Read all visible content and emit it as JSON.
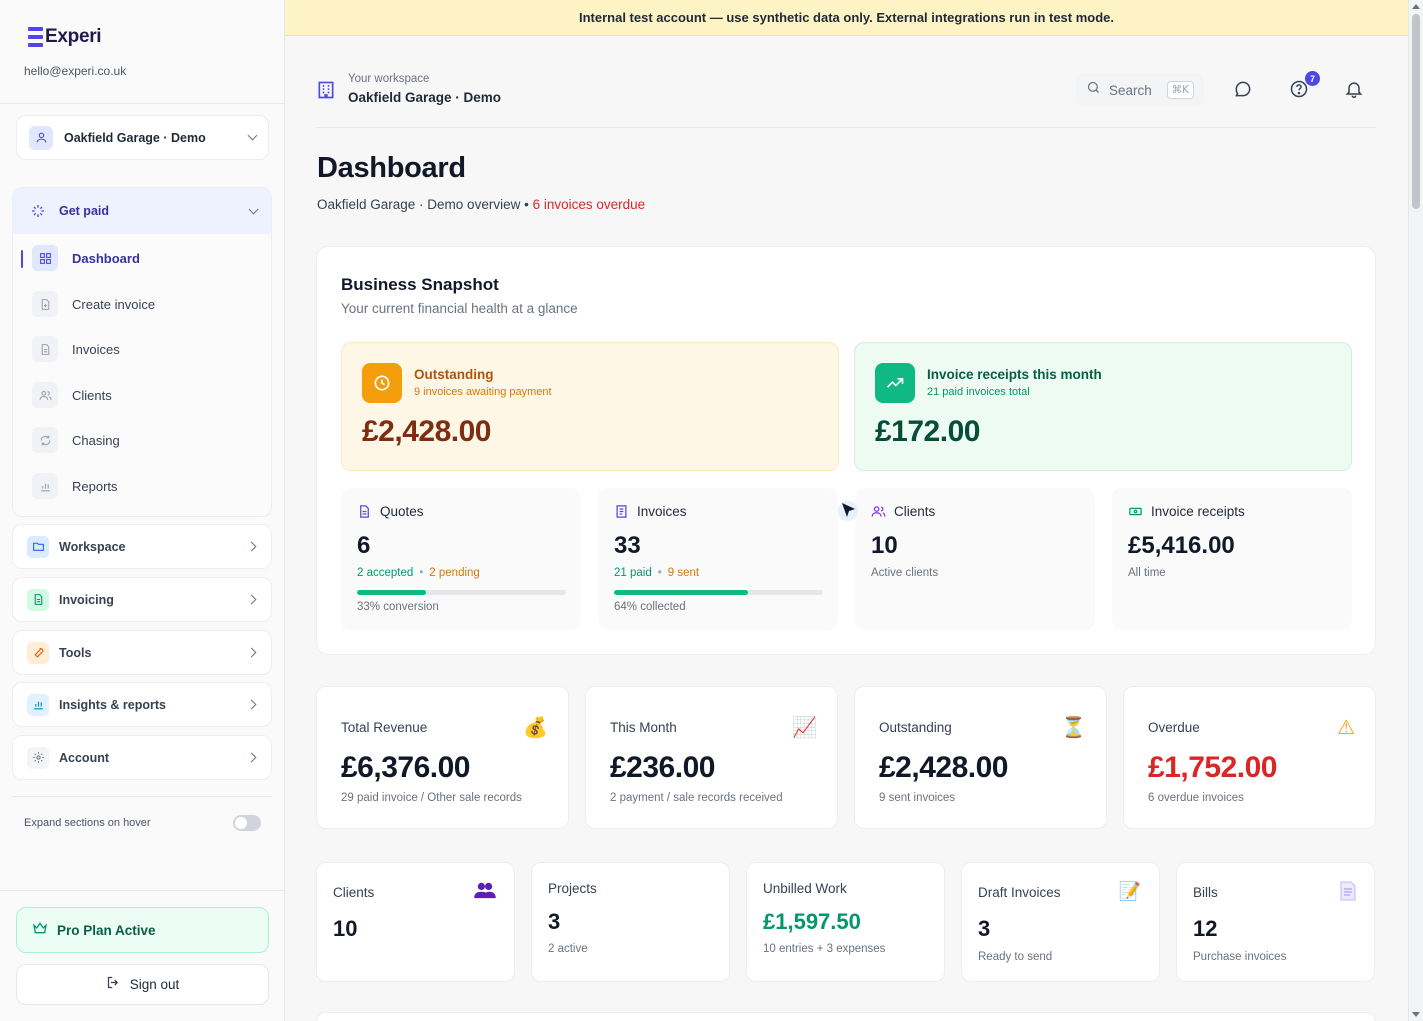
{
  "sidebar": {
    "brand": "Experi",
    "email": "hello@experi.co.uk",
    "workspace_select": "Oakfield Garage · Demo",
    "get_paid": {
      "label": "Get paid",
      "items": [
        {
          "label": "Dashboard",
          "icon": "grid-icon"
        },
        {
          "label": "Create invoice",
          "icon": "file-plus-icon"
        },
        {
          "label": "Invoices",
          "icon": "file-text-icon"
        },
        {
          "label": "Clients",
          "icon": "users-icon"
        },
        {
          "label": "Chasing",
          "icon": "refresh-icon"
        },
        {
          "label": "Reports",
          "icon": "bar-chart-icon"
        }
      ]
    },
    "sections": [
      {
        "label": "Workspace",
        "icon": "folder-icon",
        "color": "#2563eb"
      },
      {
        "label": "Invoicing",
        "icon": "document-icon",
        "color": "#059669"
      },
      {
        "label": "Tools",
        "icon": "wrench-icon",
        "color": "#ea580c"
      },
      {
        "label": "Insights & reports",
        "icon": "chart-icon",
        "color": "#0284c7"
      },
      {
        "label": "Account",
        "icon": "gear-icon",
        "color": "#6b7280"
      }
    ],
    "expand_hover_label": "Expand sections on hover",
    "expand_hover_enabled": false,
    "pro_plan": "Pro Plan Active",
    "sign_out": "Sign out"
  },
  "banner": "Internal test account — use synthetic data only. External integrations run in test mode.",
  "topbar": {
    "workspace_caption": "Your workspace",
    "workspace_name": "Oakfield Garage · Demo",
    "search_label": "Search",
    "search_shortcut": "⌘K",
    "help_badge": "7"
  },
  "page": {
    "title": "Dashboard",
    "subtitle": "Oakfield Garage · Demo overview",
    "subtitle_sep": " • ",
    "overdue_note": "6 invoices overdue"
  },
  "snapshot": {
    "title": "Business Snapshot",
    "subtitle": "Your current financial health at a glance",
    "outstanding": {
      "title": "Outstanding",
      "sub": "9 invoices awaiting payment",
      "value": "£2,428.00"
    },
    "receipts_month": {
      "title": "Invoice receipts this month",
      "sub": "21 paid invoices total",
      "value": "£172.00"
    },
    "quotes": {
      "label": "Quotes",
      "value": "6",
      "accepted": "2 accepted",
      "dot": "•",
      "pending": "2 pending",
      "progress": 33,
      "foot": "33% conversion"
    },
    "invoices": {
      "label": "Invoices",
      "value": "33",
      "paid": "21 paid",
      "dot": "•",
      "sent": "9 sent",
      "progress": 64,
      "foot": "64% collected"
    },
    "clients": {
      "label": "Clients",
      "value": "10",
      "meta": "Active clients"
    },
    "receipts": {
      "label": "Invoice receipts",
      "value": "£5,416.00",
      "meta": "All time"
    }
  },
  "stats": [
    {
      "title": "Total Revenue",
      "value": "£6,376.00",
      "meta": "29 paid invoice / Other sale records",
      "icon": "money-bag-icon"
    },
    {
      "title": "This Month",
      "value": "£236.00",
      "meta": "2 payment / sale records received",
      "icon": "chart-up-icon"
    },
    {
      "title": "Outstanding",
      "value": "£2,428.00",
      "meta": "9 sent invoices",
      "icon": "hourglass-icon"
    },
    {
      "title": "Overdue",
      "value": "£1,752.00",
      "meta": "6 overdue invoices",
      "icon": "warning-icon"
    }
  ],
  "cards": [
    {
      "title": "Clients",
      "value": "10",
      "meta": "",
      "icon": "people-icon"
    },
    {
      "title": "Projects",
      "value": "3",
      "meta": "2 active",
      "icon": ""
    },
    {
      "title": "Unbilled Work",
      "value": "£1,597.50",
      "meta": "10 entries + 3 expenses",
      "icon": ""
    },
    {
      "title": "Draft Invoices",
      "value": "3",
      "meta": "Ready to send",
      "icon": "memo-icon"
    },
    {
      "title": "Bills",
      "value": "12",
      "meta": "Purchase invoices",
      "icon": "page-icon"
    }
  ],
  "colors": {
    "accent": "#4f46e5",
    "success": "#10b981",
    "danger": "#dc2626",
    "warning": "#f59e0b"
  }
}
